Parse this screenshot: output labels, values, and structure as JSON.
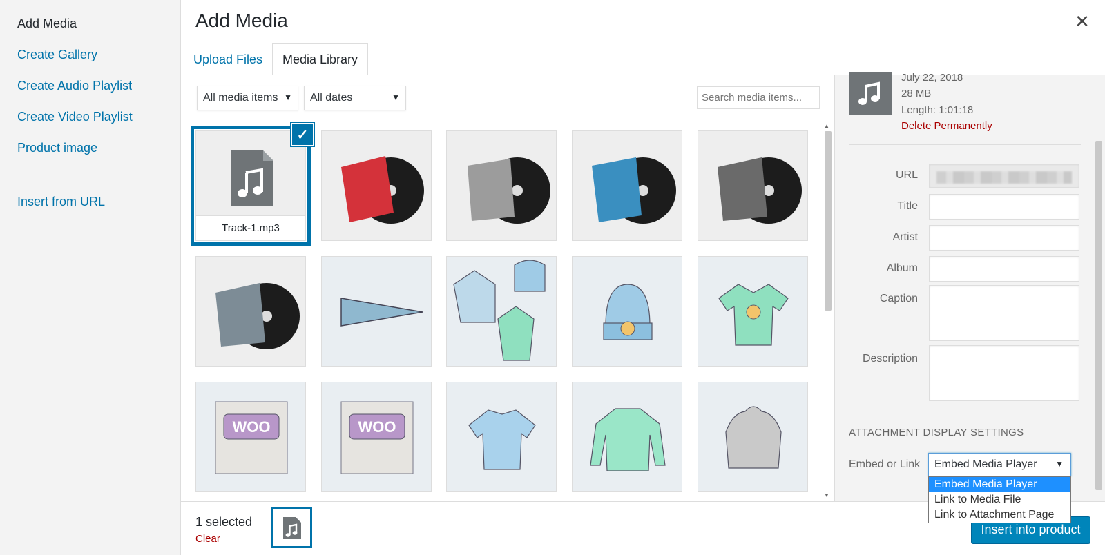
{
  "menu": {
    "items": [
      "Add Media",
      "Create Gallery",
      "Create Audio Playlist",
      "Create Video Playlist",
      "Product image"
    ],
    "insert_from_url": "Insert from URL"
  },
  "frame": {
    "title": "Add Media",
    "close_glyph": "✕",
    "tabs": {
      "upload": "Upload Files",
      "library": "Media Library"
    }
  },
  "toolbar": {
    "type_filter": "All media items",
    "date_filter": "All dates",
    "search_placeholder": "Search media items..."
  },
  "grid": {
    "selected_filename": "Track-1.mp3",
    "items": [
      "audio-file-icon",
      "vinyl-album-red",
      "vinyl-album-grey",
      "vinyl-album-blue",
      "vinyl-album-dark",
      "vinyl-album-woo",
      "wordpress-pennant",
      "hoodie-beanie-tshirt-set",
      "beanie",
      "vneck-tshirt",
      "woo-single-poster",
      "woo-album-poster",
      "polo-shirt",
      "long-sleeve-shirt",
      "hoodie-grey"
    ]
  },
  "details": {
    "date": "July 22, 2018",
    "size": "28 MB",
    "length": "Length: 1:01:18",
    "delete": "Delete Permanently",
    "labels": {
      "url": "URL",
      "title": "Title",
      "artist": "Artist",
      "album": "Album",
      "caption": "Caption",
      "description": "Description"
    },
    "display_settings_title": "ATTACHMENT DISPLAY SETTINGS",
    "embed_label": "Embed or Link",
    "embed_selected": "Embed Media Player",
    "embed_options": [
      "Embed Media Player",
      "Link to Media File",
      "Link to Attachment Page"
    ]
  },
  "footer": {
    "selected_count": "1 selected",
    "clear": "Clear",
    "insert": "Insert into product"
  },
  "colors": {
    "accent": "#0073aa",
    "button": "#0085ba",
    "danger": "#a00"
  }
}
